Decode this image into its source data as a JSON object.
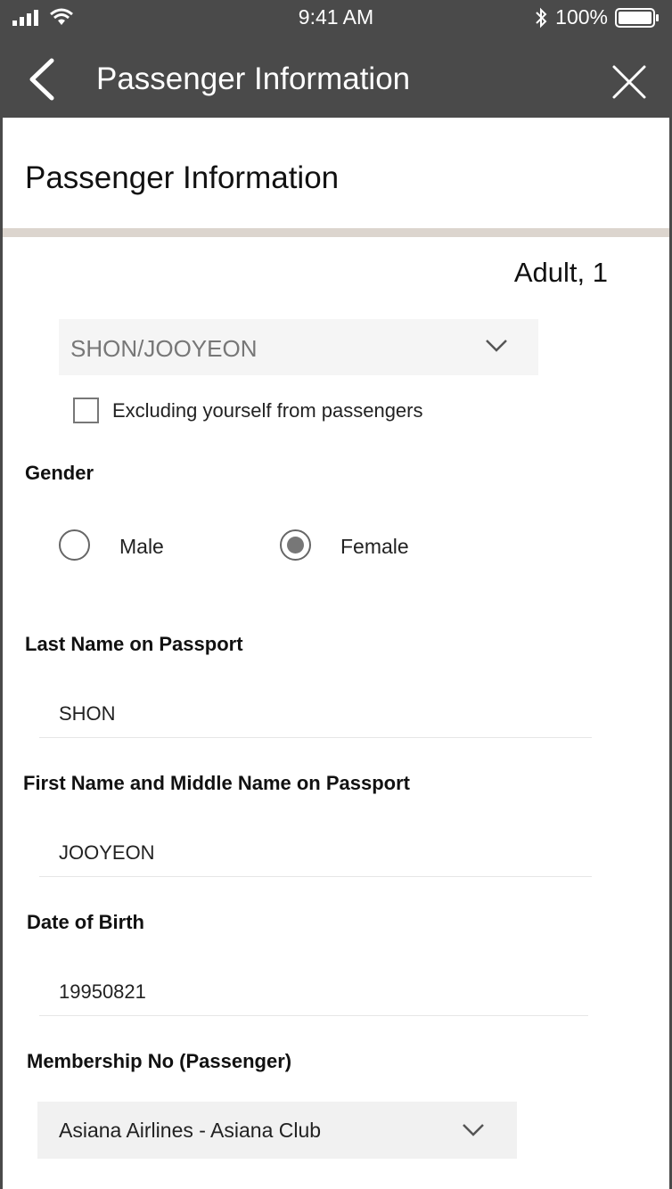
{
  "status_bar": {
    "time": "9:41 AM",
    "battery": "100%",
    "icons": [
      "signal-icon",
      "wifi-icon",
      "bluetooth-icon",
      "battery-icon"
    ]
  },
  "header": {
    "title": "Passenger Information",
    "icons": [
      "back-chevron-icon",
      "close-icon"
    ]
  },
  "page": {
    "section_title": "Passenger Information",
    "passenger_type": "Adult, 1",
    "passenger_select": {
      "selected": "SHON/JOOYEON"
    },
    "exclude_checkbox": {
      "label": "Excluding yourself from passengers",
      "checked": false
    }
  },
  "gender": {
    "label": "Gender",
    "options": [
      {
        "label": "Male",
        "selected": false
      },
      {
        "label": "Female",
        "selected": true
      }
    ]
  },
  "last_name": {
    "label": "Last Name on Passport",
    "value": "SHON"
  },
  "first_name": {
    "label": "First Name and Middle Name on Passport",
    "value": "JOOYEON"
  },
  "dob": {
    "label": "Date of Birth",
    "value": "19950821"
  },
  "membership": {
    "label": "Membership No (Passenger)",
    "selected": "Asiana Airlines - Asiana Club"
  },
  "colors": {
    "header_bg": "#4a4a4a",
    "divider": "#dcd5ce",
    "select_bg": "#f5f5f5"
  }
}
